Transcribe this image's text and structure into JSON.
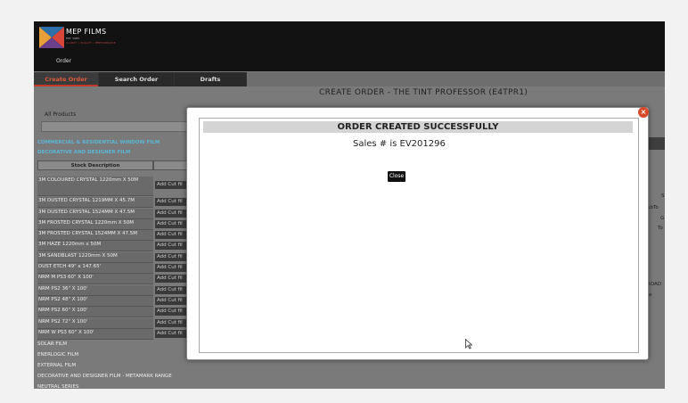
{
  "header": {
    "brand": "MEP FILMS",
    "brand_sub": "EST. 1983",
    "brand_sub2": "CLARITY • QUALITY • PERFORMANCE",
    "nav_order": "Order"
  },
  "tabs": [
    {
      "label": "Create Order",
      "active": true
    },
    {
      "label": "Search Order",
      "active": false
    },
    {
      "label": "Drafts",
      "active": false
    }
  ],
  "page_title": "CREATE ORDER - THE TINT PROFESSOR (E4TPR1)",
  "filters": {
    "all_products_label": "All Products",
    "category_1": "COMMERCIAL & RESIDENTIAL WINDOW FILM",
    "category_2": "DECORATIVE AND DESIGNER FILM"
  },
  "table": {
    "header": "Stock Description",
    "cut_label": "Add Cut fil",
    "rows": [
      "3M COLOURED CRYSTAL 1220mm X 50M",
      "3M DUSTED CRYSTAL 1219MM X 45.7M",
      "3M DUSTED CRYSTAL 1524MM X 47.5M",
      "3M FROSTED CRYSTAL 1220mm X 50M",
      "3M FROSTED CRYSTAL 1524MM X 47.5M",
      "3M HAZE 1220mm x 50M",
      "3M SANDBLAST 1220mm X 50M",
      "DUST ETCH 49\" x 147.65'",
      "NRM M PS3 60\" X 100'",
      "NRM PS2 36\" X 100'",
      "NRM PS2 48\" X 100'",
      "NRM PS2 60\" X 100'",
      "NRM PS2 72\" X 100'",
      "NRM W PS3 60\" X 100'"
    ]
  },
  "categories_below": [
    "SOLAR FILM",
    "ENERLOGIC FILM",
    "EXTERNAL FILM",
    "DECORATIVE AND DESIGNER FILM - METAMARK RANGE",
    "NEUTRAL SERIES"
  ],
  "right_labels": [
    "S",
    "ubTo",
    "G",
    "To",
    "ROAD",
    "e"
  ],
  "modal": {
    "title": "ORDER CREATED SUCCESSFULLY",
    "message": "Sales # is EV201296",
    "close_label": "Close",
    "close_x": "×"
  },
  "colors": {
    "accent": "#c0392b",
    "header_bg": "#121212",
    "category_blue": "#5cb6d6"
  }
}
